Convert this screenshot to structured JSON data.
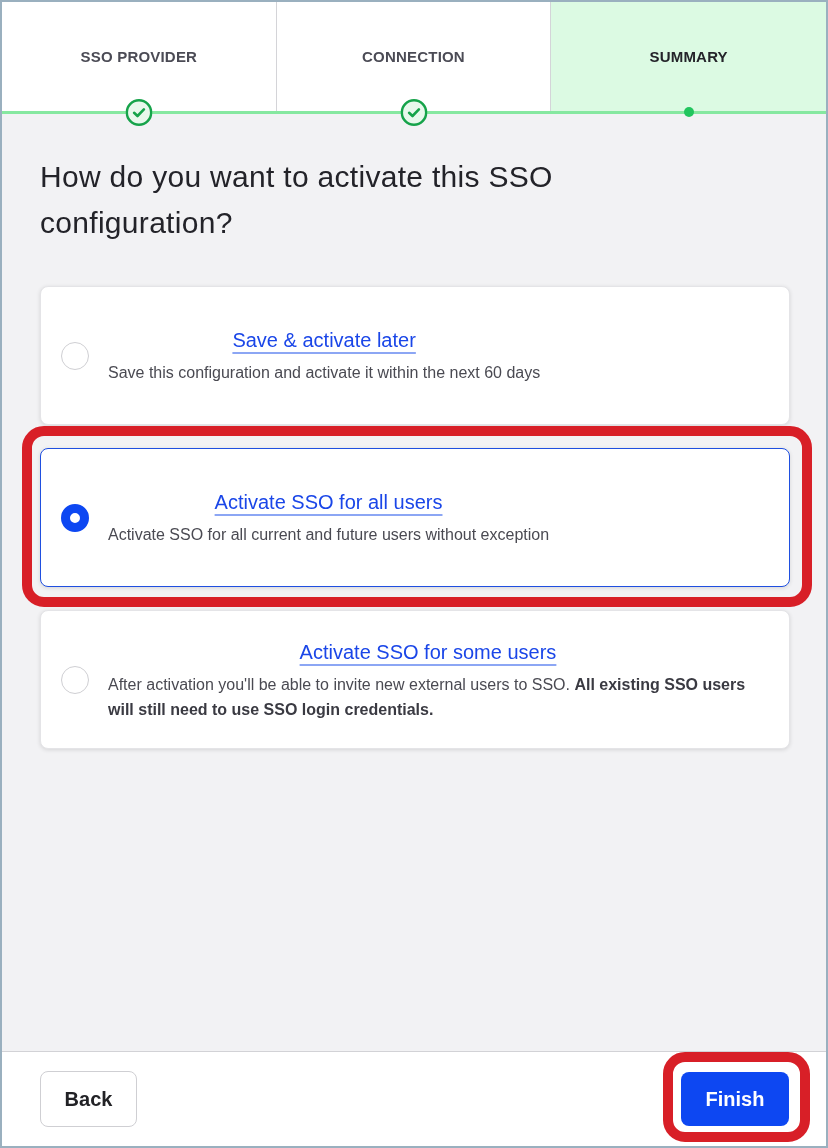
{
  "steps": [
    {
      "label": "SSO PROVIDER",
      "completed": true,
      "selected": false
    },
    {
      "label": "CONNECTION",
      "completed": true,
      "selected": false
    },
    {
      "label": "SUMMARY",
      "completed": false,
      "selected": true
    }
  ],
  "heading": "How do you want to activate this SSO configuration?",
  "options": [
    {
      "title": "Save & activate later",
      "description": "Save this configuration and activate it within the next 60 days",
      "selected": false,
      "highlighted": false
    },
    {
      "title": "Activate SSO for all users",
      "description": "Activate SSO for all current and future users without exception",
      "selected": true,
      "highlighted": true
    },
    {
      "title": "Activate SSO for some users",
      "description": "After activation you'll be able to invite new external users to SSO. **All existing SSO users will still need to use SSO login credentials.**",
      "selected": false,
      "highlighted": false
    }
  ],
  "buttons": [
    {
      "label": "Back",
      "kind": "secondary",
      "highlighted": false
    },
    {
      "label": "Finish",
      "kind": "primary",
      "highlighted": true
    }
  ]
}
